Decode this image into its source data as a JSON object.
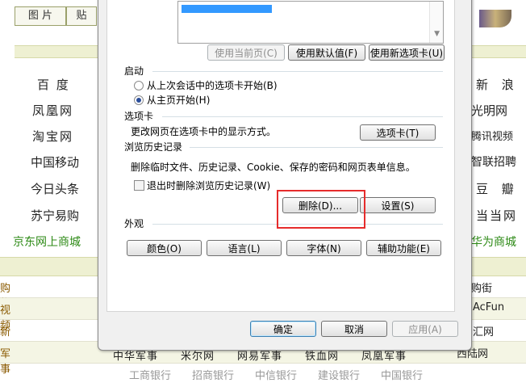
{
  "background": {
    "top_tabs": [
      "图 片",
      "贴"
    ],
    "sites_left": [
      "百 度",
      "凤凰网",
      "淘宝网",
      "中国移动",
      "今日头条",
      "苏宁易购"
    ],
    "sites_left_green": "京东网上商城",
    "sites_right": [
      "新 浪",
      "光明网",
      "腾讯视频",
      "智联招聘",
      "豆 瓣",
      "当当网"
    ],
    "sites_right_green": "华为商城",
    "categories": [
      {
        "label": "购 物",
        "right": "购街"
      },
      {
        "label": "视 频",
        "right": "AcFun"
      },
      {
        "label": "新 闻",
        "right": "汇网"
      },
      {
        "label": "军 事",
        "right": "西陆网"
      }
    ],
    "bottom_strip": "中华军事　　米尔网　　网易军事　　铁血网　　凤凰军事",
    "bottom_strip2": "工商银行　　招商银行　　中信银行　　建设银行　　中国银行"
  },
  "dialog": {
    "home_buttons": {
      "use_current": "使用当前页(C)",
      "use_default": "使用默认值(F)",
      "use_new_tab": "使用新选项卡(U)"
    },
    "startup": {
      "title": "启动",
      "option_last_session": "从上次会话中的选项卡开始(B)",
      "option_home_page": "从主页开始(H)",
      "selected": "option_home_page"
    },
    "tabs": {
      "title": "选项卡",
      "description": "更改网页在选项卡中的显示方式。",
      "button": "选项卡(T)"
    },
    "history": {
      "title": "浏览历史记录",
      "description": "删除临时文件、历史记录、Cookie、保存的密码和网页表单信息。",
      "checkbox_label": "退出时删除浏览历史记录(W)",
      "checkbox_checked": false,
      "delete_button": "删除(D)...",
      "settings_button": "设置(S)"
    },
    "appearance": {
      "title": "外观",
      "colors_button": "颜色(O)",
      "languages_button": "语言(L)",
      "fonts_button": "字体(N)",
      "accessibility_button": "辅助功能(E)"
    },
    "footer": {
      "ok": "确定",
      "cancel": "取消",
      "apply": "应用(A)"
    }
  },
  "colors": {
    "highlight_box": "#e62c2c",
    "site_green": "#2d8a16",
    "band_green": "#eef0d2"
  }
}
